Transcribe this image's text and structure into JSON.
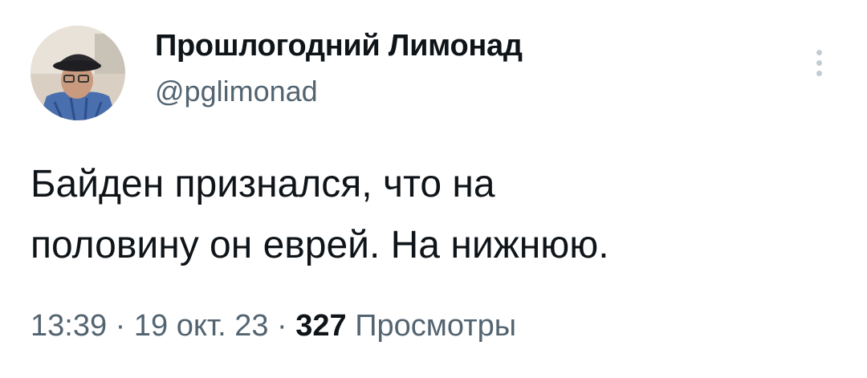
{
  "author": {
    "display_name": "Прошлогодний Лимонад",
    "handle": "@pglimonad"
  },
  "tweet": {
    "lines": [
      "Байден признался, что на",
      "половину он еврей. На нижнюю."
    ]
  },
  "meta": {
    "time": "13:39",
    "separator": " · ",
    "date": "19 окт. 23",
    "views_count": "327",
    "views_label": "Просмотры"
  },
  "icons": {
    "more": "more-vertical-icon",
    "avatar": "avatar-image"
  }
}
